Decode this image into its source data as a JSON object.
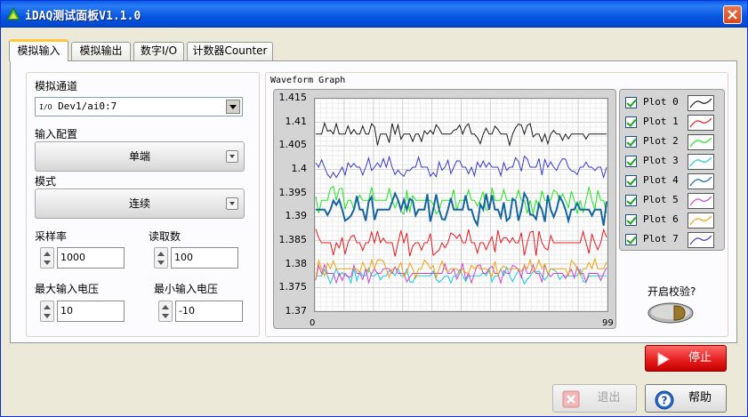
{
  "window": {
    "title": "iDAQ测试面板V1.1.0"
  },
  "tabs": [
    {
      "label": "模拟输入",
      "active": true
    },
    {
      "label": "模拟输出",
      "active": false
    },
    {
      "label": "数字I/O",
      "active": false
    },
    {
      "label": "计数器Counter",
      "active": false
    }
  ],
  "left_panel": {
    "channel": {
      "label": "模拟通道",
      "prefix": "I/O",
      "value": "Dev1/ai0:7"
    },
    "input_config": {
      "label": "输入配置",
      "value": "单端"
    },
    "mode": {
      "label": "模式",
      "value": "连续"
    },
    "sample_rate": {
      "label": "采样率",
      "value": "1000"
    },
    "read_count": {
      "label": "读取数",
      "value": "100"
    },
    "max_voltage": {
      "label": "最大输入电压",
      "value": "10"
    },
    "min_voltage": {
      "label": "最小输入电压",
      "value": "-10"
    }
  },
  "graph": {
    "title": "Waveform Graph",
    "yticks": [
      "1.415",
      "1.41",
      "1.405",
      "1.4",
      "1.395",
      "1.39",
      "1.385",
      "1.38",
      "1.375",
      "1.37"
    ],
    "xticks": [
      "0",
      "99"
    ]
  },
  "chart_data": {
    "type": "line",
    "title": "Waveform Graph",
    "xlabel": "",
    "ylabel": "",
    "xlim": [
      0,
      99
    ],
    "ylim": [
      1.37,
      1.415
    ],
    "grid": true,
    "legend": "right",
    "series": [
      {
        "name": "Plot 0",
        "color": "#1a1a1a",
        "base": 1.4075,
        "spread": 0.002
      },
      {
        "name": "Plot 1",
        "color": "#e8191f",
        "base": 1.3845,
        "spread": 0.0025
      },
      {
        "name": "Plot 2",
        "color": "#1ee51e",
        "base": 1.3935,
        "spread": 0.0025
      },
      {
        "name": "Plot 3",
        "color": "#19c7e0",
        "base": 1.3775,
        "spread": 0.0015
      },
      {
        "name": "Plot 4",
        "color": "#1565a0",
        "base": 1.3915,
        "spread": 0.003
      },
      {
        "name": "Plot 5",
        "color": "#cc44cc",
        "base": 1.378,
        "spread": 0.0018
      },
      {
        "name": "Plot 6",
        "color": "#f0a010",
        "base": 1.379,
        "spread": 0.0018
      },
      {
        "name": "Plot 7",
        "color": "#3a3acc",
        "base": 1.4005,
        "spread": 0.002
      }
    ]
  },
  "legend": {
    "items": [
      "Plot 0",
      "Plot 1",
      "Plot 2",
      "Plot 3",
      "Plot 4",
      "Plot 5",
      "Plot 6",
      "Plot 7"
    ]
  },
  "verify": {
    "label": "开启校验?"
  },
  "buttons": {
    "stop": "停止",
    "exit": "退出",
    "help": "帮助"
  },
  "colors": {
    "titlebar": "#0a5ee8",
    "stop": "#e41b1b",
    "tab_highlight": "#ffc83c"
  }
}
